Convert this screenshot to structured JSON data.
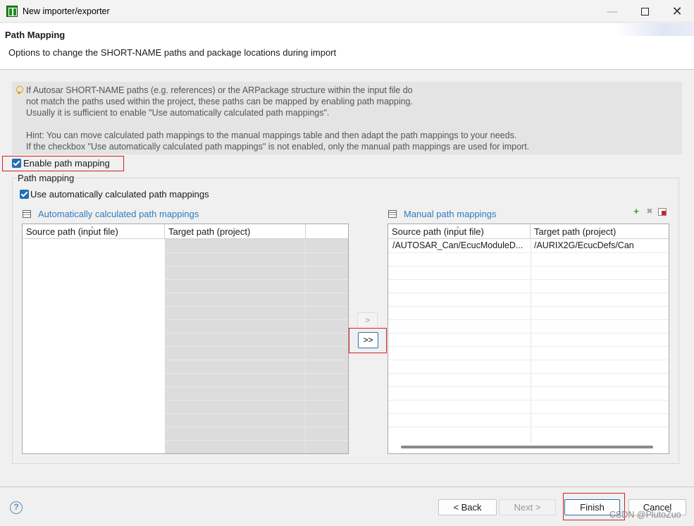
{
  "window": {
    "title": "New importer/exporter",
    "minimize_glyph": "—",
    "close_glyph": "✕"
  },
  "header": {
    "title": "Path Mapping",
    "description": "Options to change the SHORT-NAME paths and package locations during import"
  },
  "info": {
    "icon": "lightbulb-icon",
    "lines": [
      "If Autosar SHORT-NAME paths (e.g. references) or the ARPackage structure within the input file do",
      "not match the paths used within the project, these paths can be mapped by enabling path mapping.",
      "Usually it is sufficient to enable \"Use automatically calculated path mappings\".",
      "",
      "Hint: You can move calculated path mappings to the manual mappings table and then adapt the path mappings to your needs.",
      "If the checkbox \"Use automatically calculated path mappings\" is not enabled, only the manual path mappings are used for import."
    ]
  },
  "enable_mapping": {
    "label": "Enable path mapping",
    "checked": true
  },
  "group": {
    "title": "Path mapping",
    "use_auto": {
      "label": "Use automatically calculated path mappings",
      "checked": true
    }
  },
  "auto_table": {
    "title": "Automatically calculated path mappings",
    "columns": [
      "Source path (input file)",
      "Target path (project)",
      ""
    ],
    "rows": []
  },
  "transfer": {
    "move_one_label": ">",
    "move_all_label": ">>"
  },
  "manual_table": {
    "title": "Manual path mappings",
    "columns": [
      "Source path (input file)",
      "Target path (project)"
    ],
    "rows": [
      {
        "source": "/AUTOSAR_Can/EcucModuleD...",
        "target": "/AURIX2G/EcucDefs/Can"
      }
    ],
    "tools": {
      "add": "+",
      "remove": "✖"
    }
  },
  "footer": {
    "help_glyph": "?",
    "back_label": "< Back",
    "next_label": "Next >",
    "finish_label": "Finish",
    "cancel_label": "Cancel",
    "watermark": "CSDN @PlutoZuo"
  }
}
